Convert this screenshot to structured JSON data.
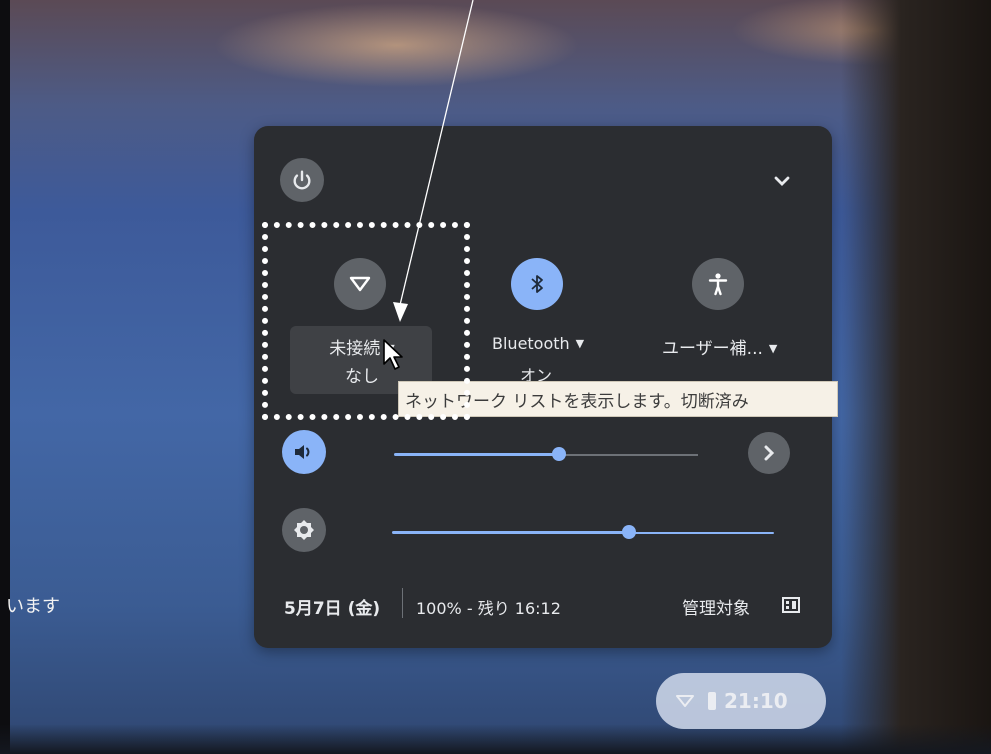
{
  "background": {
    "left_text": "います"
  },
  "panel": {
    "network": {
      "label": "未接続",
      "sub": "なし",
      "icon": "wifi-icon"
    },
    "bluetooth": {
      "label": "Bluetooth",
      "sub": "オン",
      "icon": "bluetooth-icon"
    },
    "accessibility": {
      "label": "ユーザー補...",
      "icon": "accessibility-icon"
    },
    "tooltip": "ネットワーク リストを表示します。切断済み",
    "volume": {
      "level": 0.55
    },
    "brightness": {
      "level": 0.62
    },
    "date": "5月7日 (金)",
    "battery": "100% - 残り 16:12",
    "managed": "管理対象"
  },
  "shelf": {
    "time": "21:10"
  },
  "colors": {
    "accent": "#8ab4f8",
    "panel": "#2b2d31",
    "tile": "#5f6368"
  }
}
